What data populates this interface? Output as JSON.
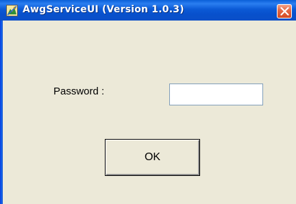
{
  "window": {
    "title": "AwgServiceUI (Version 1.0.3)",
    "icon": "app-icon",
    "close_icon": "close-icon",
    "titlebar_color": "#0a5fd8",
    "background": "#ece9d8"
  },
  "form": {
    "password_label": "Password :",
    "password_value": "",
    "ok_label": "OK"
  }
}
